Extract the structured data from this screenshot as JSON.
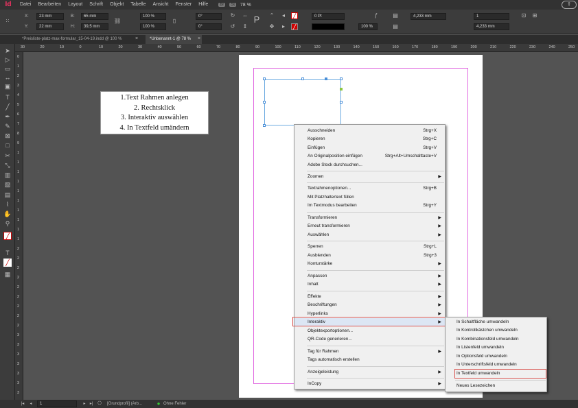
{
  "app": {
    "logo": "Id"
  },
  "menu": [
    "Datei",
    "Bearbeiten",
    "Layout",
    "Schrift",
    "Objekt",
    "Tabelle",
    "Ansicht",
    "Fenster",
    "Hilfe"
  ],
  "menu_extra": {
    "br": "Br",
    "st": "St",
    "zoom": "78 %"
  },
  "control": {
    "x_label": "X:",
    "x_value": "23 mm",
    "y_label": "Y:",
    "y_value": "22 mm",
    "w_label": "B:",
    "w_value": "65 mm",
    "h_label": "H:",
    "h_value": "39,5 mm",
    "scale_x": "100 %",
    "scale_y": "100 %",
    "rot": "0°",
    "shear": "0°",
    "stroke": "0 Pt",
    "opacity": "100 %",
    "dim1": "4,233 mm",
    "dim2": "4,233 mm",
    "cols": "1"
  },
  "tabs": [
    {
      "label": "*Preisliste-platz-max-formular_15-04-19.indd @ 100 %"
    },
    {
      "label": "*Unbenannt-1 @ 78 %"
    }
  ],
  "ruler_h": [
    "30",
    "20",
    "10",
    "0",
    "10",
    "20",
    "30",
    "40",
    "50",
    "60",
    "70",
    "80",
    "90",
    "100",
    "110",
    "120",
    "130",
    "140",
    "150",
    "160",
    "170",
    "180",
    "190",
    "200",
    "210",
    "220",
    "230",
    "240",
    "250"
  ],
  "ruler_v": [
    "0",
    "1",
    "2",
    "3",
    "4",
    "5",
    "6",
    "7",
    "8",
    "9",
    "1",
    "1",
    "1",
    "1",
    "1",
    "1",
    "1",
    "1",
    "1",
    "1",
    "2",
    "2",
    "2",
    "2",
    "2",
    "2",
    "2",
    "2",
    "2",
    "3",
    "3",
    "3",
    "3",
    "3",
    "3",
    "3"
  ],
  "note": {
    "line1": "1.Text Rahmen anlegen",
    "line2": "2. Rechtsklick",
    "line3": "3. Interaktiv auswählen",
    "line4": "4.  In Textfeld umändern"
  },
  "context_menu": [
    {
      "label": "Ausschneiden",
      "shortcut": "Strg+X"
    },
    {
      "label": "Kopieren",
      "shortcut": "Strg+C"
    },
    {
      "label": "Einfügen",
      "shortcut": "Strg+V"
    },
    {
      "label": "An Originalposition einfügen",
      "shortcut": "Strg+Alt+Umschalttaste+V"
    },
    {
      "label": "Adobe Stock durchsuchen...",
      "shortcut": ""
    },
    {
      "label": "Zoomen",
      "shortcut": "",
      "sub": true
    },
    {
      "label": "Textrahmenoptionen...",
      "shortcut": "Strg+B"
    },
    {
      "label": "Mit Platzhaltertext füllen",
      "shortcut": ""
    },
    {
      "label": "Im Textmodus bearbeiten",
      "shortcut": "Strg+Y"
    },
    {
      "label": "Transformieren",
      "shortcut": "",
      "sub": true
    },
    {
      "label": "Erneut transformieren",
      "shortcut": "",
      "sub": true
    },
    {
      "label": "Auswählen",
      "shortcut": "",
      "sub": true
    },
    {
      "label": "Sperren",
      "shortcut": "Strg+L"
    },
    {
      "label": "Ausblenden",
      "shortcut": "Strg+3"
    },
    {
      "label": "Konturstärke",
      "shortcut": "",
      "sub": true
    },
    {
      "label": "Anpassen",
      "shortcut": "",
      "sub": true
    },
    {
      "label": "Inhalt",
      "shortcut": "",
      "sub": true
    },
    {
      "label": "Effekte",
      "shortcut": "",
      "sub": true
    },
    {
      "label": "Beschriftungen",
      "shortcut": "",
      "sub": true
    },
    {
      "label": "Hyperlinks",
      "shortcut": "",
      "sub": true
    },
    {
      "label": "Interaktiv",
      "shortcut": "",
      "sub": true
    },
    {
      "label": "Objektexportoptionen...",
      "shortcut": ""
    },
    {
      "label": "QR-Code generieren...",
      "shortcut": ""
    },
    {
      "label": "Tag für Rahmen",
      "shortcut": "",
      "sub": true
    },
    {
      "label": "Tags automatisch erstellen",
      "shortcut": ""
    },
    {
      "label": "Anzeigeleistung",
      "shortcut": "",
      "sub": true
    },
    {
      "label": "InCopy",
      "shortcut": "",
      "sub": true
    }
  ],
  "submenu": [
    {
      "label": "In Schaltfläche umwandeln"
    },
    {
      "label": "In Kontrollkästchen umwandeln"
    },
    {
      "label": "In Kombinationsfeld umwandeln"
    },
    {
      "label": "In Listenfeld umwandeln"
    },
    {
      "label": "In Optionsfeld umwandeln"
    },
    {
      "label": "In Unterschriftsfeld umwandeln"
    },
    {
      "label": "In Textfeld umwandeln"
    },
    {
      "label": "Neues Lesezeichen"
    }
  ],
  "status": {
    "page": "1",
    "profile": "[Grundprofil] (Arb...",
    "errors": "Ohne Fehler"
  },
  "colors": {
    "highlight": "#d9534f",
    "frame": "#6aa9e0",
    "margin": "#e066e0",
    "logo": "#ff3366"
  }
}
